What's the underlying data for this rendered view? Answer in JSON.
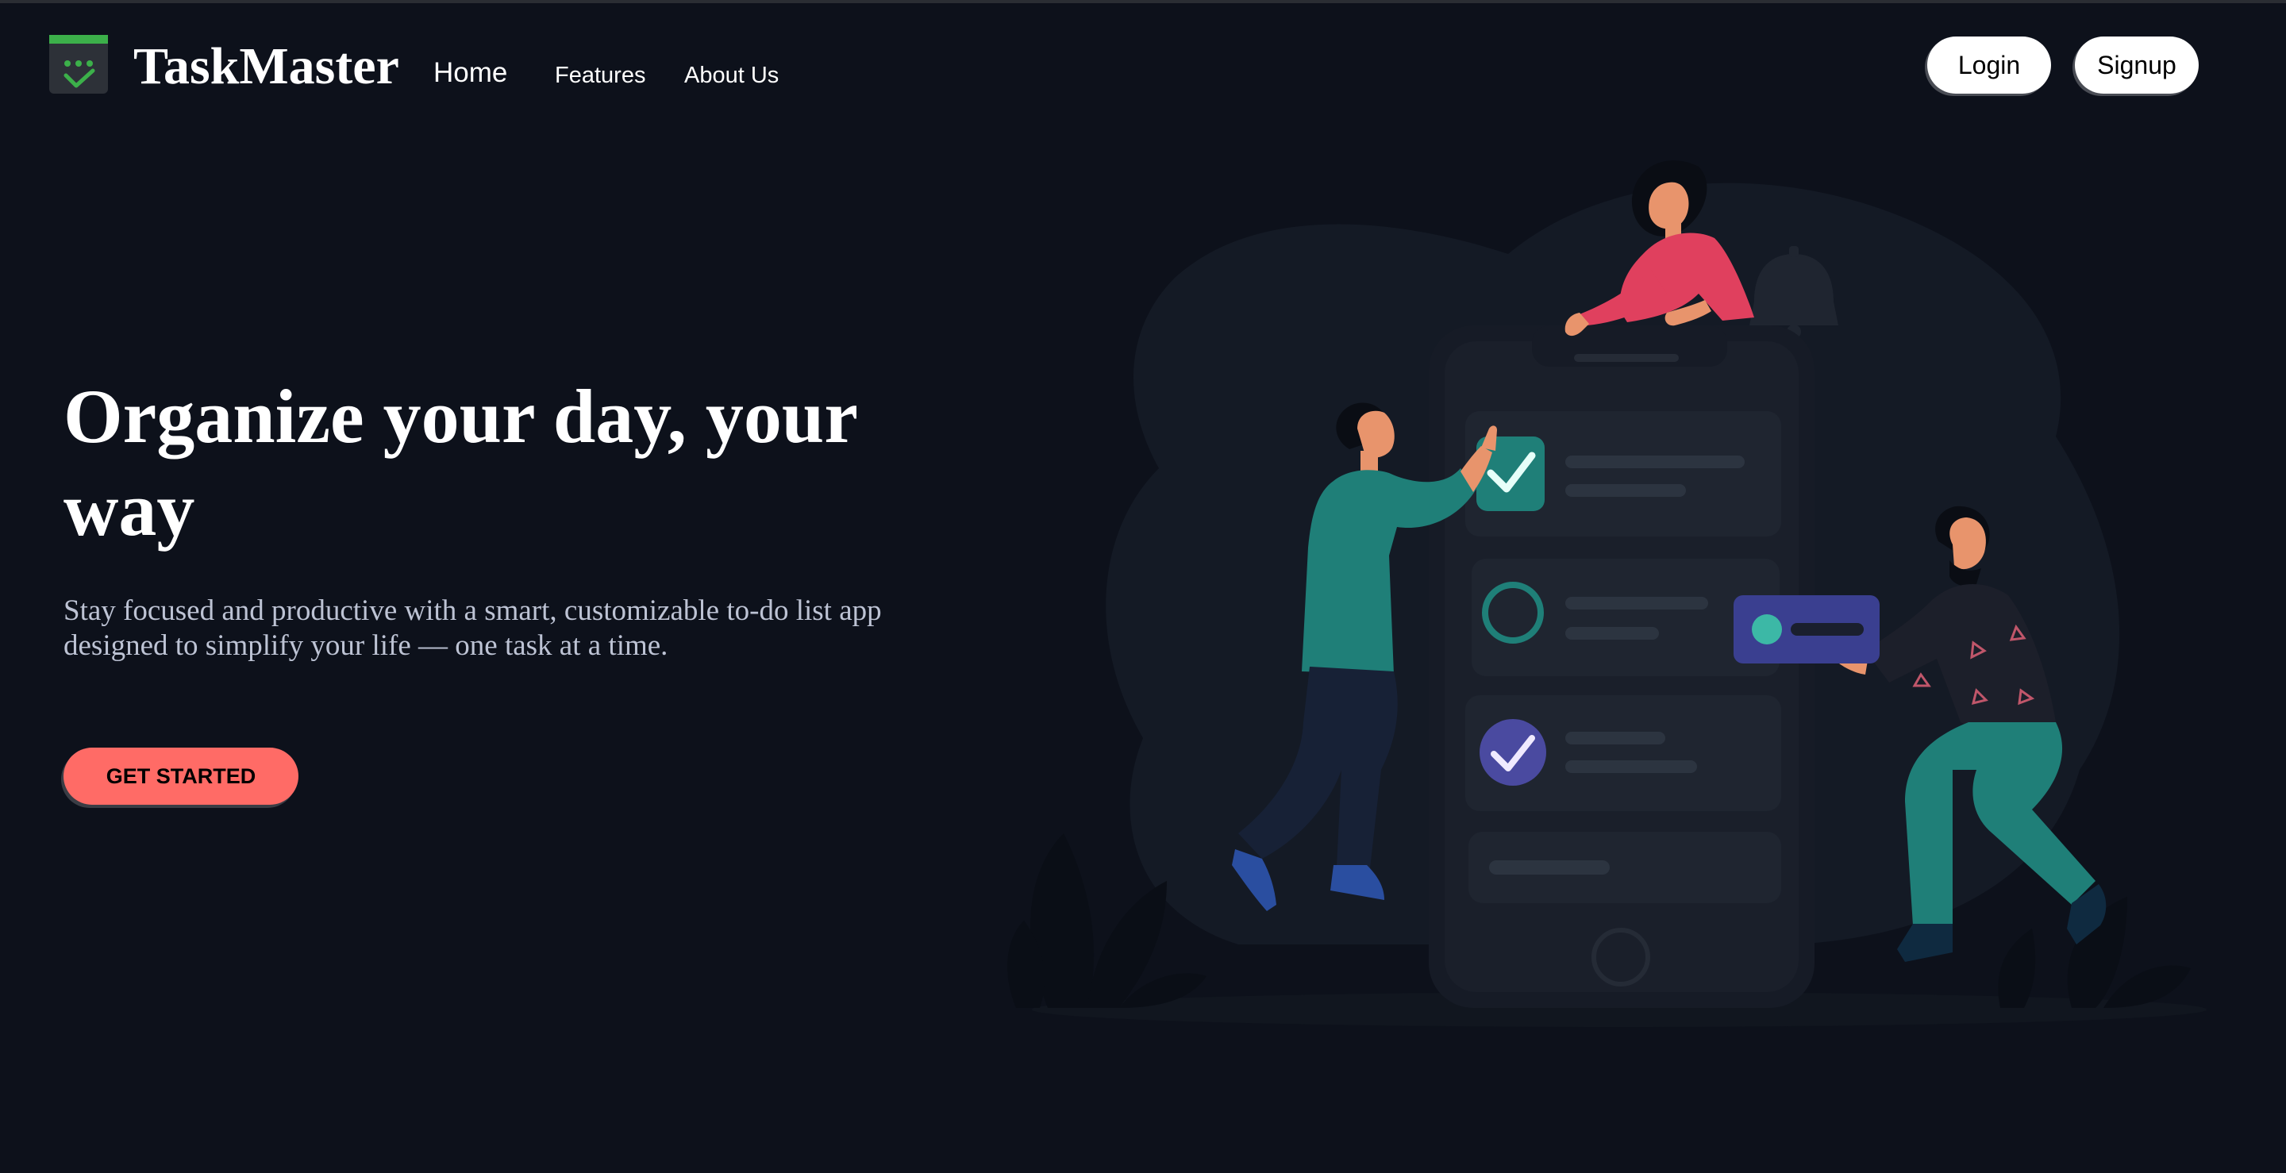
{
  "nav": {
    "brand": "TaskMaster",
    "links": [
      {
        "label": "Home"
      },
      {
        "label": "Features"
      },
      {
        "label": "About Us"
      }
    ],
    "login_label": "Login",
    "signup_label": "Signup"
  },
  "hero": {
    "title": "Organize your day, your way",
    "subtitle": "Stay focused and productive with a smart, customizable to-do list app designed to simplify your life — one task at a time.",
    "cta_label": "GET STARTED"
  },
  "colors": {
    "background": "#0d111b",
    "accent": "#ff6b66",
    "logo_green": "#3cb04a",
    "teal": "#1f7f78",
    "purple": "#4a4aa0",
    "pink": "#e0405e"
  },
  "icons": {
    "logo": "calendar-check-icon",
    "task_done": "checkmark-icon",
    "task_pending": "circle-icon",
    "notification": "bell-icon"
  }
}
